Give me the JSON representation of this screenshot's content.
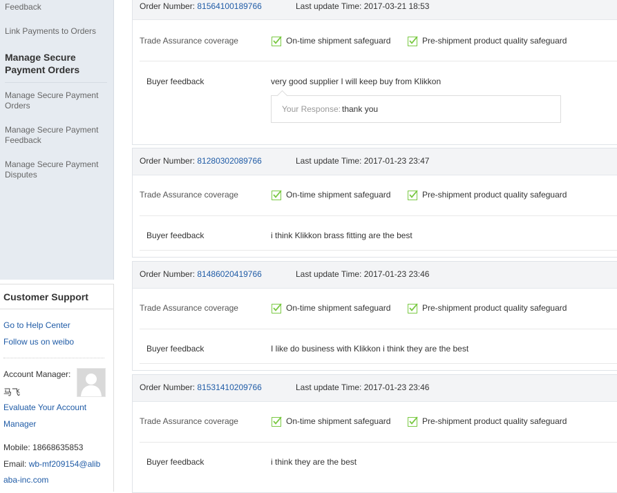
{
  "sidebar": {
    "items": [
      {
        "label": "Feedback"
      },
      {
        "label": "Link Payments to Orders"
      },
      {
        "label": "Manage Secure Payment Orders"
      },
      {
        "label": "Manage Secure Payment Orders"
      },
      {
        "label": "Manage Secure Payment Feedback"
      },
      {
        "label": "Manage Secure Payment Disputes"
      }
    ]
  },
  "support": {
    "title": "Customer Support",
    "help_link": "Go to Help Center",
    "weibo_link": "Follow us on weibo",
    "account_manager_label": "Account Manager:",
    "account_manager_name": "马飞",
    "evaluate_link_line1": "Evaluate Your Account",
    "evaluate_link_line2": "Manager",
    "mobile_label": "Mobile:",
    "mobile": "18668635853",
    "email_label": "Email:",
    "email_line1": "wb-mf209154@alib",
    "email_line2": "aba-inc.com"
  },
  "labels": {
    "order_number": "Order Number:",
    "last_update": "Last update Time:",
    "trade_assurance": "Trade Assurance coverage",
    "ontime": "On-time shipment safeguard",
    "preship": "Pre-shipment product quality safeguard",
    "buyer_feedback": "Buyer feedback",
    "your_response": "Your Response:"
  },
  "orders": [
    {
      "number": "81564100189766",
      "time": "2017-03-21 18:53",
      "feedback": "very good supplier I will keep buy from Klikkon",
      "response": "thank you"
    },
    {
      "number": "81280302089766",
      "time": "2017-01-23 23:47",
      "feedback": "i think Klikkon brass fitting are the best"
    },
    {
      "number": "81486020419766",
      "time": "2017-01-23 23:46",
      "feedback": "I like do business with Klikkon i think they are the best"
    },
    {
      "number": "81531410209766",
      "time": "2017-01-23 23:46",
      "feedback": "i think they are the best"
    }
  ],
  "colors": {
    "link": "#1f5ba6",
    "check": "#7ac943",
    "sidebar_bg": "#e6ebf1"
  }
}
